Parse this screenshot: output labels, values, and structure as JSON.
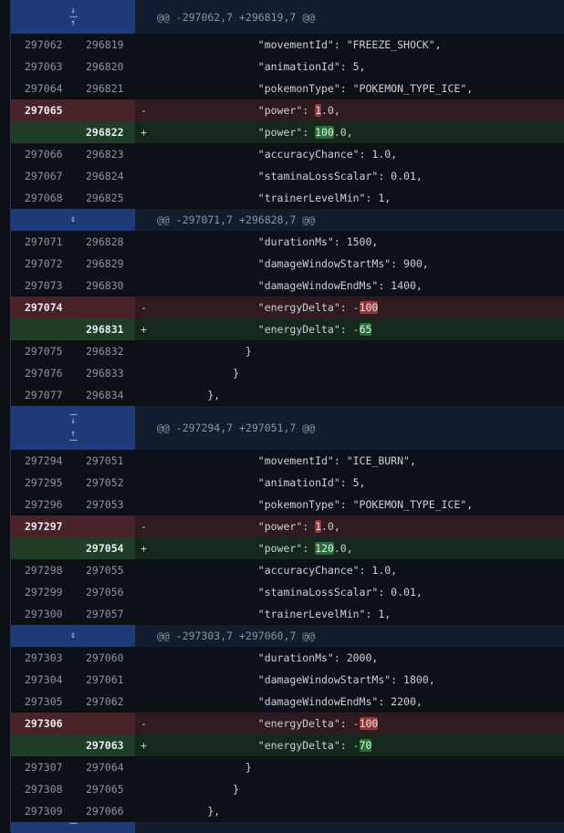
{
  "hunks": [
    "@@ -297062,7 +296819,7 @@",
    "@@ -297071,7 +296828,7 @@",
    "@@ -297294,7 +297051,7 @@",
    "@@ -297303,7 +297060,7 @@"
  ],
  "blocks": [
    [
      {
        "type": "ctx",
        "old": "297062",
        "new": "296819",
        "code": "                \"movementId\": \"FREEZE_SHOCK\","
      },
      {
        "type": "ctx",
        "old": "297063",
        "new": "296820",
        "code": "                \"animationId\": 5,"
      },
      {
        "type": "ctx",
        "old": "297064",
        "new": "296821",
        "code": "                \"pokemonType\": \"POKEMON_TYPE_ICE\","
      },
      {
        "type": "del",
        "old": "297065",
        "new": "",
        "sign": "-",
        "pre": "                \"power\": ",
        "hl": "1",
        "post": ".0,"
      },
      {
        "type": "add",
        "old": "",
        "new": "296822",
        "sign": "+",
        "pre": "                \"power\": ",
        "hl": "100",
        "post": ".0,"
      },
      {
        "type": "ctx",
        "old": "297066",
        "new": "296823",
        "code": "                \"accuracyChance\": 1.0,"
      },
      {
        "type": "ctx",
        "old": "297067",
        "new": "296824",
        "code": "                \"staminaLossScalar\": 0.01,"
      },
      {
        "type": "ctx",
        "old": "297068",
        "new": "296825",
        "code": "                \"trainerLevelMin\": 1,"
      }
    ],
    [
      {
        "type": "ctx",
        "old": "297071",
        "new": "296828",
        "code": "                \"durationMs\": 1500,"
      },
      {
        "type": "ctx",
        "old": "297072",
        "new": "296829",
        "code": "                \"damageWindowStartMs\": 900,"
      },
      {
        "type": "ctx",
        "old": "297073",
        "new": "296830",
        "code": "                \"damageWindowEndMs\": 1400,"
      },
      {
        "type": "del",
        "old": "297074",
        "new": "",
        "sign": "-",
        "pre": "                \"energyDelta\": -",
        "hl": "100",
        "post": ""
      },
      {
        "type": "add",
        "old": "",
        "new": "296831",
        "sign": "+",
        "pre": "                \"energyDelta\": -",
        "hl": "65",
        "post": ""
      },
      {
        "type": "ctx",
        "old": "297075",
        "new": "296832",
        "code": "              }"
      },
      {
        "type": "ctx",
        "old": "297076",
        "new": "296833",
        "code": "            }"
      },
      {
        "type": "ctx",
        "old": "297077",
        "new": "296834",
        "code": "        },"
      }
    ],
    [
      {
        "type": "ctx",
        "old": "297294",
        "new": "297051",
        "code": "                \"movementId\": \"ICE_BURN\","
      },
      {
        "type": "ctx",
        "old": "297295",
        "new": "297052",
        "code": "                \"animationId\": 5,"
      },
      {
        "type": "ctx",
        "old": "297296",
        "new": "297053",
        "code": "                \"pokemonType\": \"POKEMON_TYPE_ICE\","
      },
      {
        "type": "del",
        "old": "297297",
        "new": "",
        "sign": "-",
        "pre": "                \"power\": ",
        "hl": "1",
        "post": ".0,"
      },
      {
        "type": "add",
        "old": "",
        "new": "297054",
        "sign": "+",
        "pre": "                \"power\": ",
        "hl": "120",
        "post": ".0,"
      },
      {
        "type": "ctx",
        "old": "297298",
        "new": "297055",
        "code": "                \"accuracyChance\": 1.0,"
      },
      {
        "type": "ctx",
        "old": "297299",
        "new": "297056",
        "code": "                \"staminaLossScalar\": 0.01,"
      },
      {
        "type": "ctx",
        "old": "297300",
        "new": "297057",
        "code": "                \"trainerLevelMin\": 1,"
      }
    ],
    [
      {
        "type": "ctx",
        "old": "297303",
        "new": "297060",
        "code": "                \"durationMs\": 2000,"
      },
      {
        "type": "ctx",
        "old": "297304",
        "new": "297061",
        "code": "                \"damageWindowStartMs\": 1800,"
      },
      {
        "type": "ctx",
        "old": "297305",
        "new": "297062",
        "code": "                \"damageWindowEndMs\": 2200,"
      },
      {
        "type": "del",
        "old": "297306",
        "new": "",
        "sign": "-",
        "pre": "                \"energyDelta\": -",
        "hl": "100",
        "post": ""
      },
      {
        "type": "add",
        "old": "",
        "new": "297063",
        "sign": "+",
        "pre": "                \"energyDelta\": -",
        "hl": "70",
        "post": ""
      },
      {
        "type": "ctx",
        "old": "297307",
        "new": "297064",
        "code": "              }"
      },
      {
        "type": "ctx",
        "old": "297308",
        "new": "297065",
        "code": "            }"
      },
      {
        "type": "ctx",
        "old": "297309",
        "new": "297066",
        "code": "        },"
      }
    ]
  ]
}
